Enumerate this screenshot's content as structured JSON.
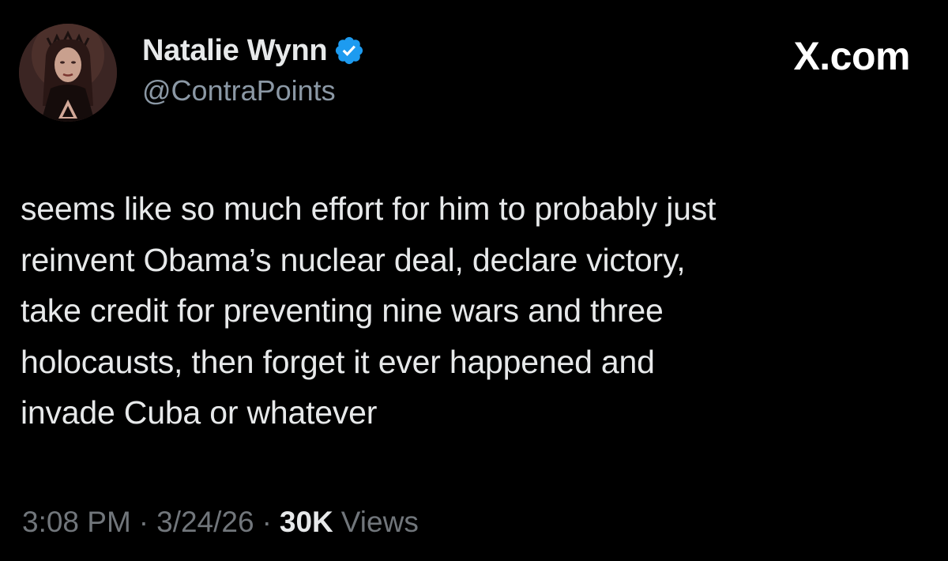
{
  "author": {
    "display_name": "Natalie Wynn",
    "handle": "@ContraPoints",
    "verified": true
  },
  "site_logo": "X.com",
  "tweet": {
    "lines": [
      "seems like so much effort for him to probably just",
      "reinvent Obama’s nuclear deal, declare victory,",
      "take credit for preventing nine wars and three",
      "holocausts, then forget it ever happened and",
      "invade Cuba or whatever"
    ]
  },
  "meta": {
    "time": "3:08 PM",
    "separator": "·",
    "date": "3/24/26",
    "views_count": "30K",
    "views_label": "Views"
  },
  "colors": {
    "background": "#000000",
    "text": "#e7e9ea",
    "secondary_text": "#71767b",
    "verified_badge": "#1d9bf0"
  },
  "icons": {
    "verified": "verified-badge-icon",
    "avatar": "profile-avatar"
  }
}
